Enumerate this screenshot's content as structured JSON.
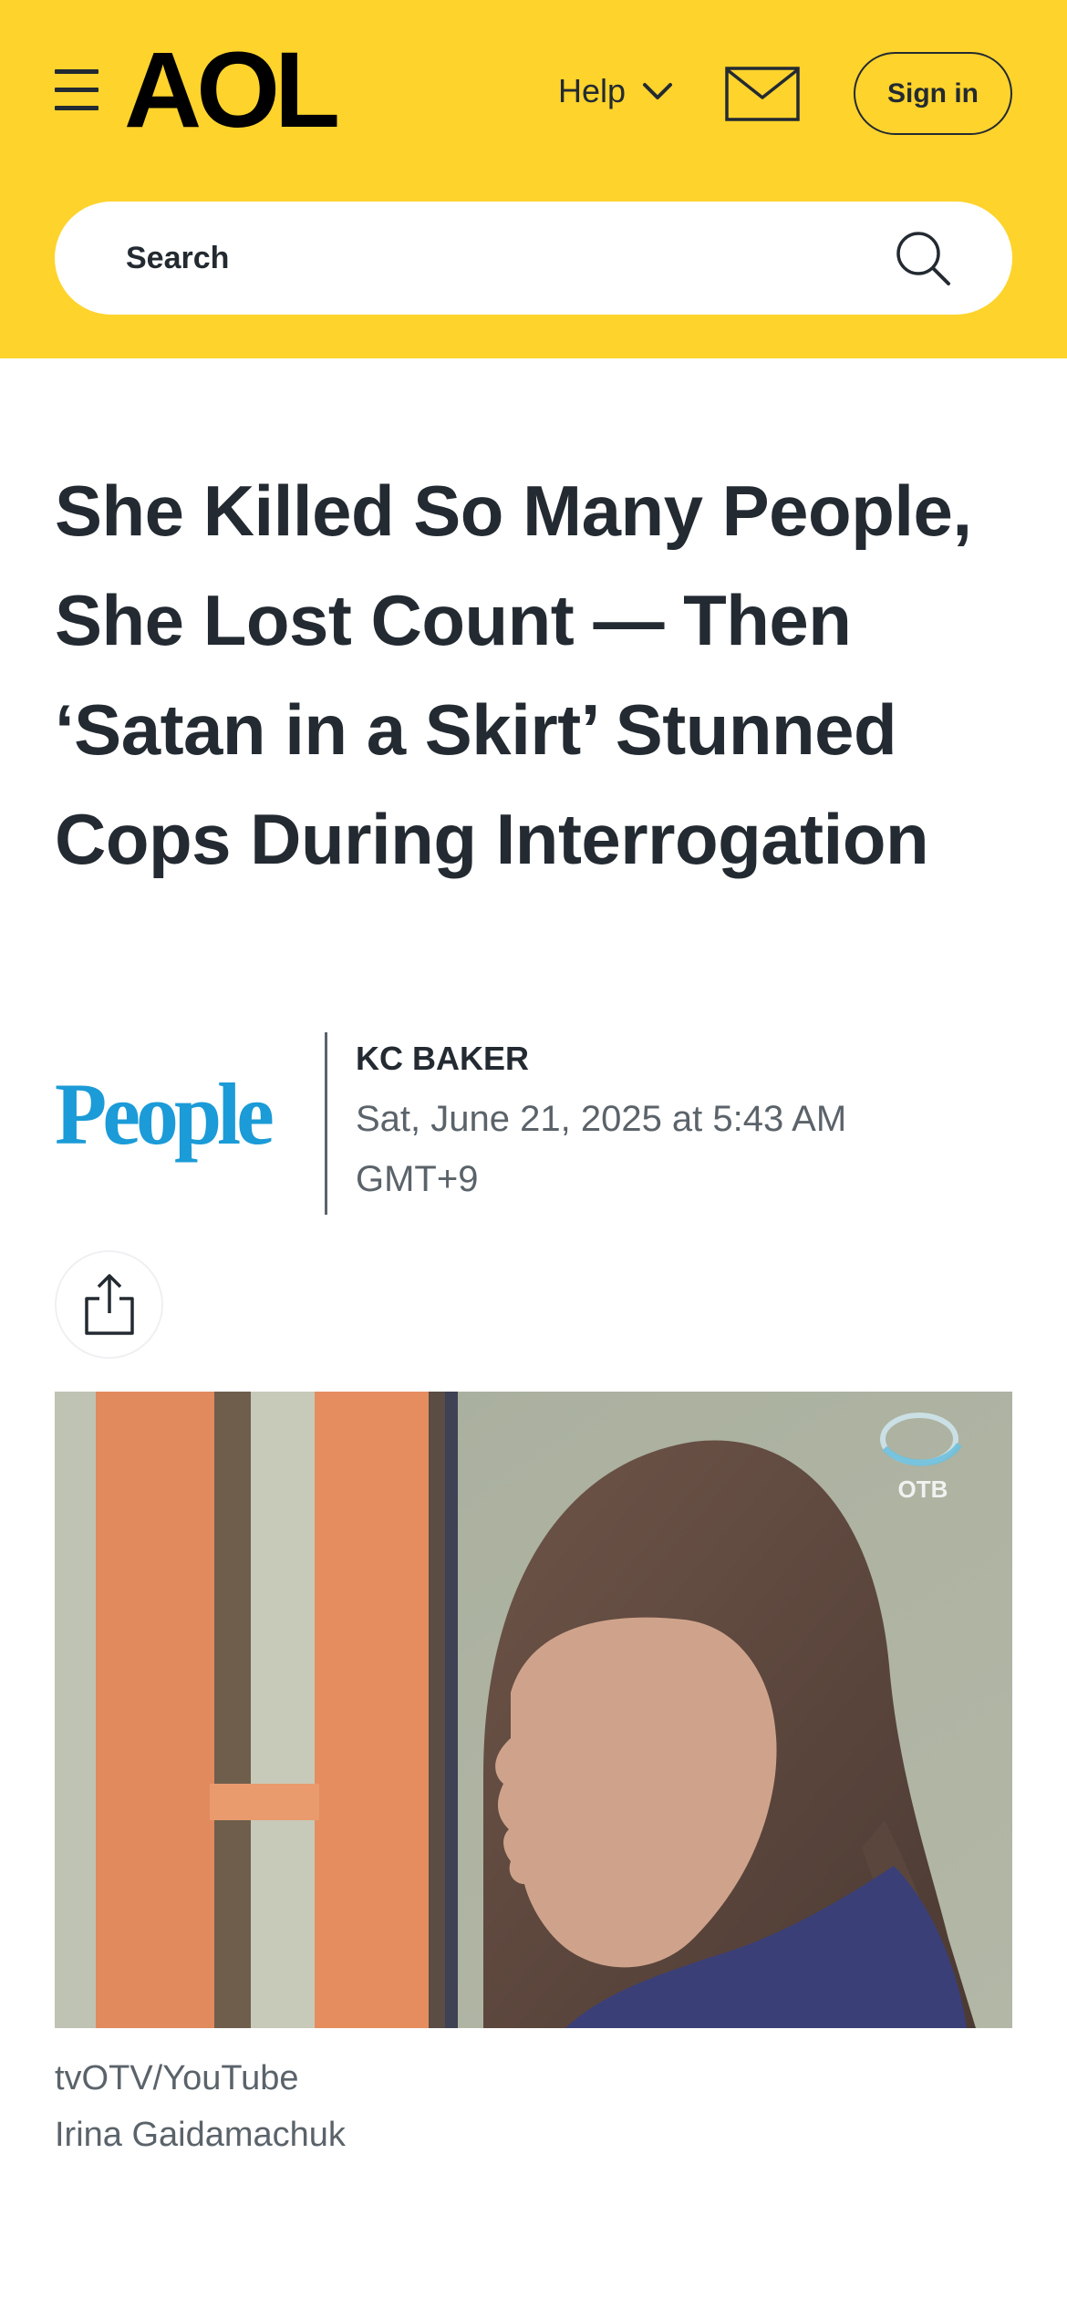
{
  "header": {
    "logo": "AOL",
    "help_label": "Help",
    "signin_label": "Sign in",
    "search_placeholder": "Search",
    "background_color": "#fed32c"
  },
  "article": {
    "headline": "She Killed So Many People, She Lost Count — Then ‘Satan in a Skirt’ Stunned Cops During Interrogation",
    "source_logo": "People",
    "author": "KC BAKER",
    "date": "Sat, June 21, 2025 at 5:43 AM GMT+9",
    "image": {
      "watermark": "OTB",
      "credit": "tvOTV/YouTube",
      "caption": "Irina Gaidamachuk"
    }
  },
  "icons": {
    "menu": "hamburger-menu-icon",
    "help": "chevron-down-icon",
    "mail": "mail-icon",
    "search": "search-icon",
    "share": "share-icon"
  },
  "colors": {
    "accent": "#fed32c",
    "text": "#232a31",
    "secondary_text": "#5b636a",
    "people_brand": "#1b9bd7"
  }
}
